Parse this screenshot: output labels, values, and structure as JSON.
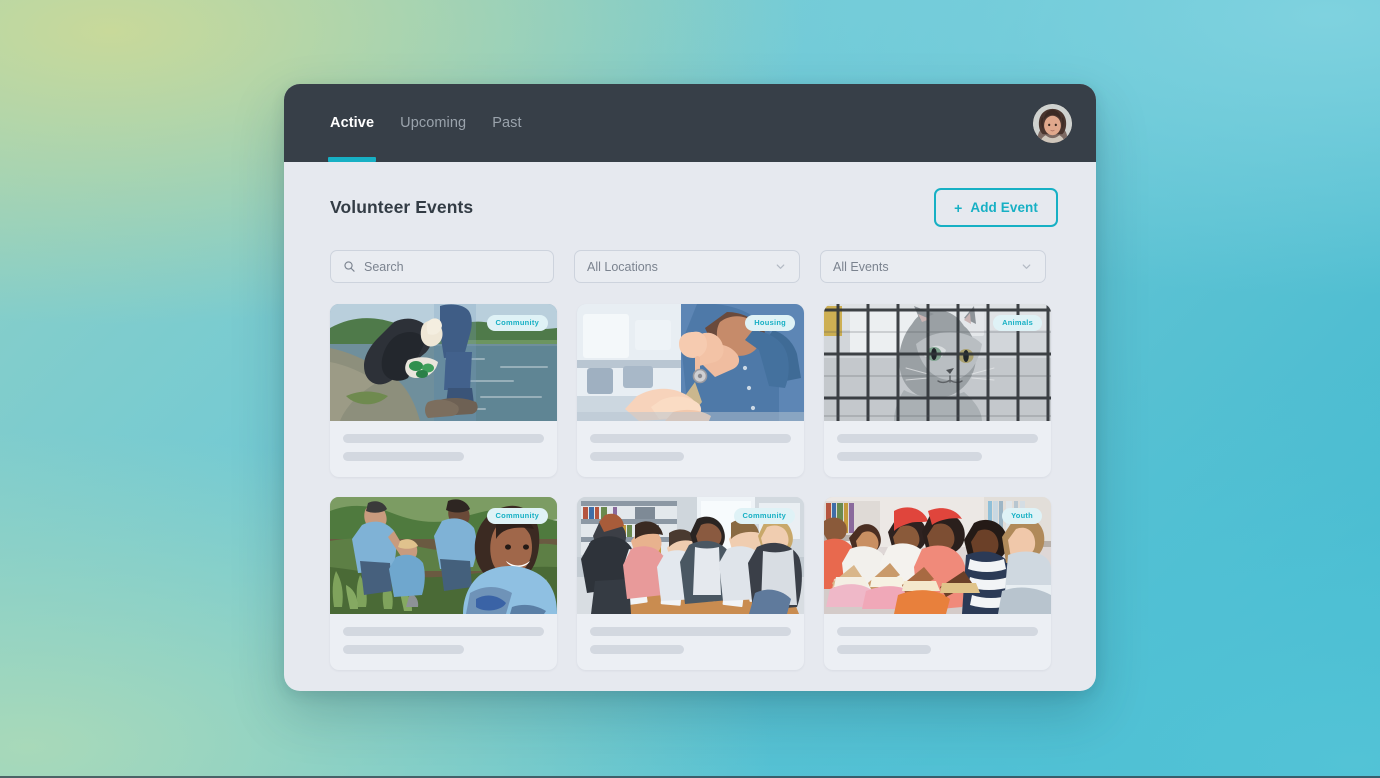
{
  "window": {
    "topbar": {
      "tabs": [
        {
          "label": "Active",
          "active": true
        },
        {
          "label": "Upcoming",
          "active": false
        },
        {
          "label": "Past",
          "active": false
        }
      ],
      "avatar_name": "user-avatar"
    },
    "page": {
      "title": "Volunteer Events",
      "add_button": {
        "label": "Add Event",
        "plus": "+"
      }
    },
    "filters": {
      "search": {
        "placeholder": "Search",
        "value": ""
      },
      "location_select": {
        "value": "All Locations"
      },
      "event_select": {
        "value": "All Events"
      }
    },
    "cards": [
      {
        "badge": "Community",
        "image": "river-cleanup-volunteer"
      },
      {
        "badge": "Housing",
        "image": "handing-over-house-keys"
      },
      {
        "badge": "Animals",
        "image": "kitten-in-shelter-cage"
      },
      {
        "badge": "Community",
        "image": "garden-planting-volunteers"
      },
      {
        "badge": "Community",
        "image": "students-around-library-table"
      },
      {
        "badge": "Youth",
        "image": "children-reading-books"
      }
    ]
  },
  "colors": {
    "accent": "#17b0c4",
    "topbar_bg": "#373f48",
    "app_bg": "#e6e9ef",
    "badge_bg": "#dff2f6",
    "skeleton": "#d3d8e0"
  }
}
